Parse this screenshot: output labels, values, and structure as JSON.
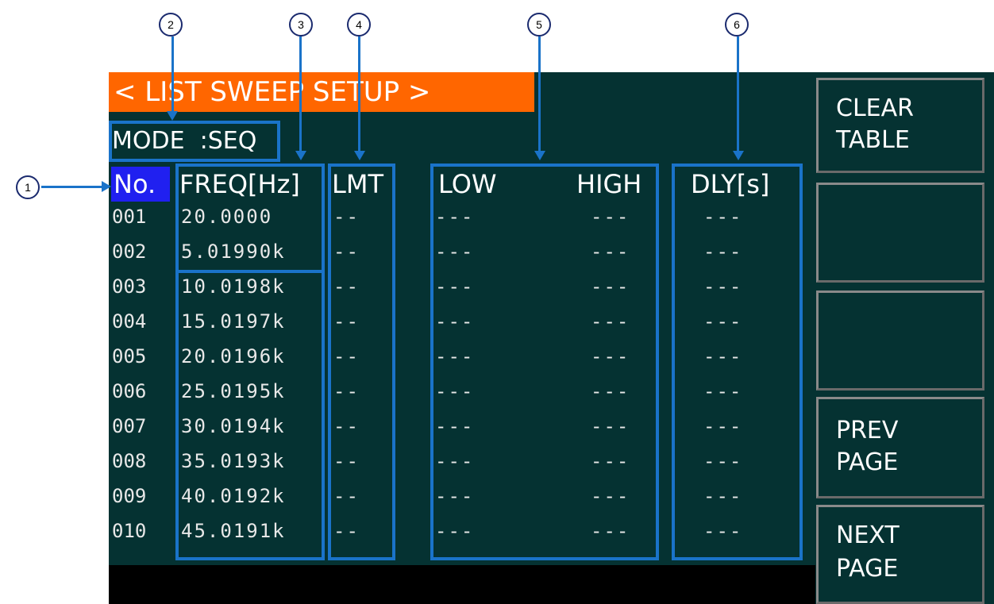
{
  "title": "< LIST SWEEP SETUP >",
  "mode": {
    "label": "MODE",
    "value": ":SEQ"
  },
  "headers": {
    "no": "No.",
    "freq": "FREQ[Hz]",
    "lmt": "LMT",
    "low": "LOW",
    "high": "HIGH",
    "dly": "DLY[s]"
  },
  "rows": [
    {
      "no": "001",
      "freq": "20.0000",
      "lmt": "--",
      "low": "---",
      "high": "---",
      "dly": "---"
    },
    {
      "no": "002",
      "freq": "5.01990k",
      "lmt": "--",
      "low": "---",
      "high": "---",
      "dly": "---"
    },
    {
      "no": "003",
      "freq": "10.0198k",
      "lmt": "--",
      "low": "---",
      "high": "---",
      "dly": "---"
    },
    {
      "no": "004",
      "freq": "15.0197k",
      "lmt": "--",
      "low": "---",
      "high": "---",
      "dly": "---"
    },
    {
      "no": "005",
      "freq": "20.0196k",
      "lmt": "--",
      "low": "---",
      "high": "---",
      "dly": "---"
    },
    {
      "no": "006",
      "freq": "25.0195k",
      "lmt": "--",
      "low": "---",
      "high": "---",
      "dly": "---"
    },
    {
      "no": "007",
      "freq": "30.0194k",
      "lmt": "--",
      "low": "---",
      "high": "---",
      "dly": "---"
    },
    {
      "no": "008",
      "freq": "35.0193k",
      "lmt": "--",
      "low": "---",
      "high": "---",
      "dly": "---"
    },
    {
      "no": "009",
      "freq": "40.0192k",
      "lmt": "--",
      "low": "---",
      "high": "---",
      "dly": "---"
    },
    {
      "no": "010",
      "freq": "45.0191k",
      "lmt": "--",
      "low": "---",
      "high": "---",
      "dly": "---"
    }
  ],
  "softkeys": [
    {
      "line1": "CLEAR",
      "line2": "TABLE"
    },
    {
      "line1": "",
      "line2": ""
    },
    {
      "line1": "",
      "line2": ""
    },
    {
      "line1": "PREV",
      "line2": "PAGE"
    },
    {
      "line1": "NEXT",
      "line2": "PAGE"
    }
  ],
  "annotations": [
    "1",
    "2",
    "3",
    "4",
    "5",
    "6"
  ],
  "colors": {
    "screen_bg": "#053232",
    "title_bg": "#ff6600",
    "selected_bg": "#2020f0",
    "annotation": "#1a73c9"
  }
}
